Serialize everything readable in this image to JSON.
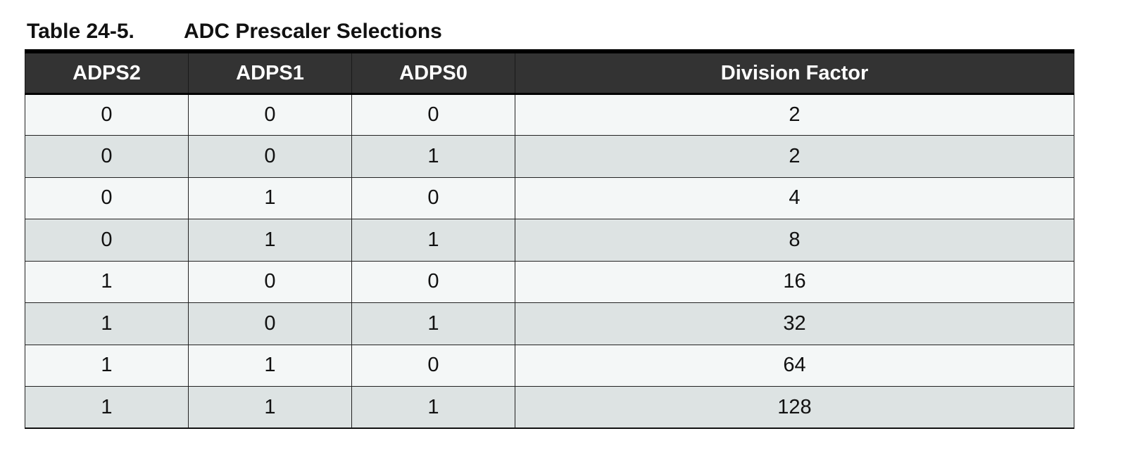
{
  "caption": {
    "number": "Table 24-5.",
    "title": "ADC Prescaler Selections"
  },
  "table": {
    "headers": [
      "ADPS2",
      "ADPS1",
      "ADPS0",
      "Division Factor"
    ],
    "rows": [
      [
        "0",
        "0",
        "0",
        "2"
      ],
      [
        "0",
        "0",
        "1",
        "2"
      ],
      [
        "0",
        "1",
        "0",
        "4"
      ],
      [
        "0",
        "1",
        "1",
        "8"
      ],
      [
        "1",
        "0",
        "0",
        "16"
      ],
      [
        "1",
        "0",
        "1",
        "32"
      ],
      [
        "1",
        "1",
        "0",
        "64"
      ],
      [
        "1",
        "1",
        "1",
        "128"
      ]
    ]
  },
  "colors": {
    "header_bg": "#333333",
    "header_text": "#ffffff",
    "row_light": "#f4f7f7",
    "row_shaded": "#dde3e3"
  }
}
